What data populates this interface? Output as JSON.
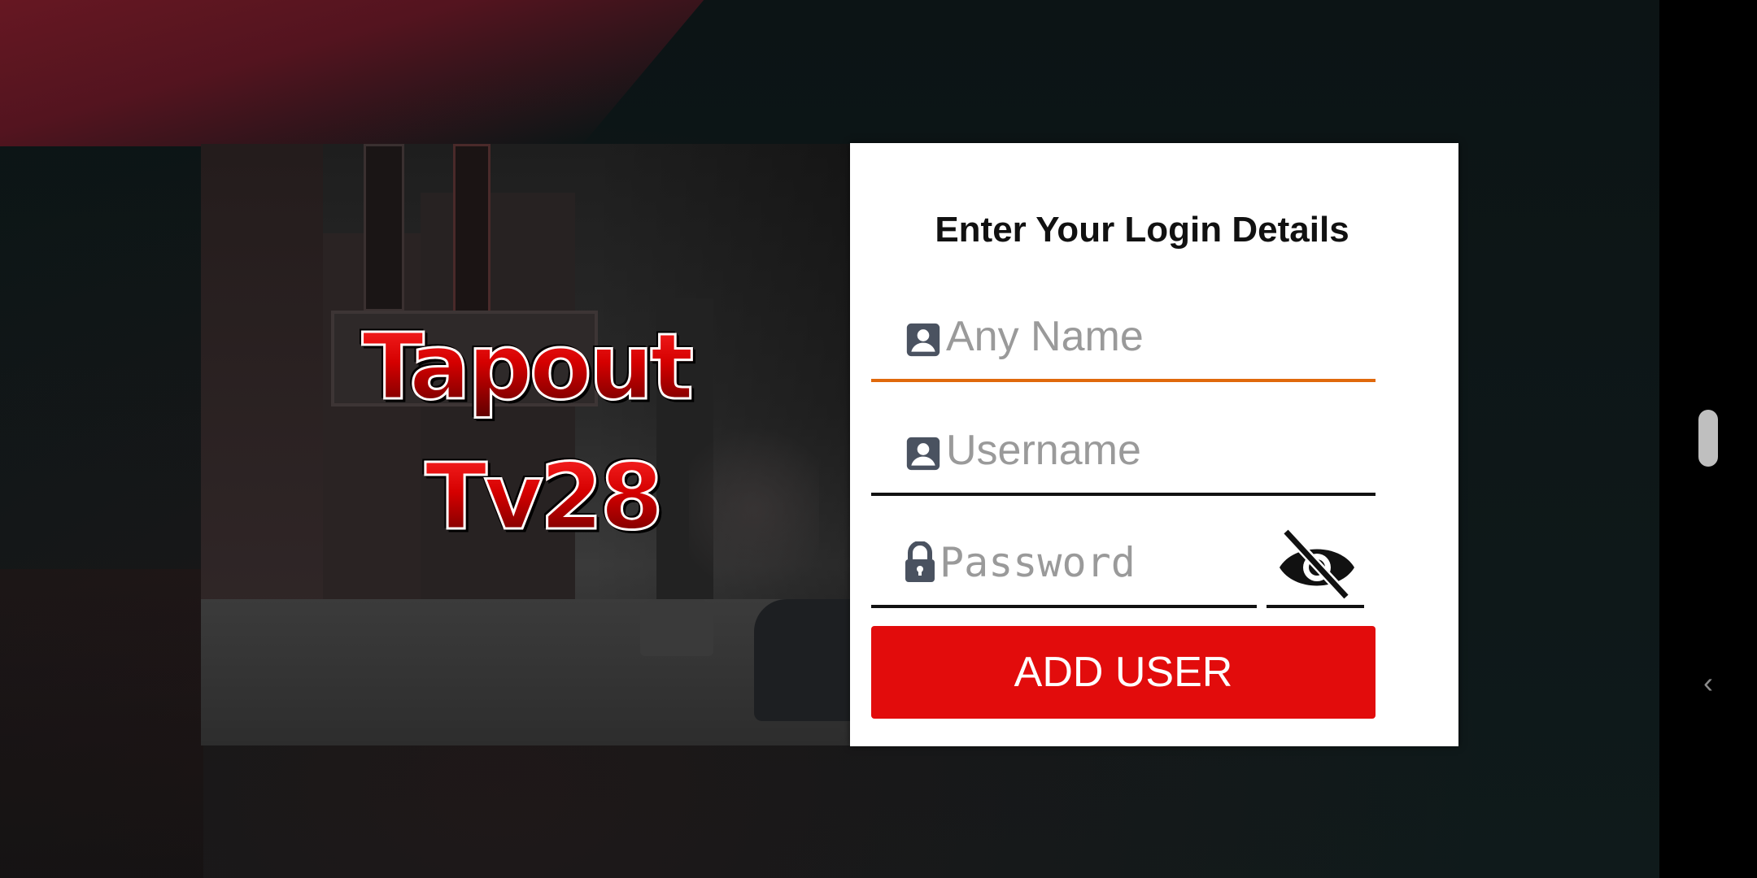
{
  "brand": {
    "line1": "Tapout",
    "line2": "Tv28"
  },
  "login": {
    "title": "Enter Your Login Details",
    "name_placeholder": "Any Name",
    "username_placeholder": "Username",
    "password_placeholder": "Password",
    "submit_label": "ADD USER"
  },
  "icons": {
    "name_field": "person-icon",
    "username_field": "person-icon",
    "password_field": "lock-icon",
    "password_toggle": "eye-off-icon",
    "nav_back": "chevron-left-icon"
  },
  "colors": {
    "accent_active_underline": "#e0690c",
    "button": "#e20c0c",
    "brand_red": "#e00a0a"
  }
}
